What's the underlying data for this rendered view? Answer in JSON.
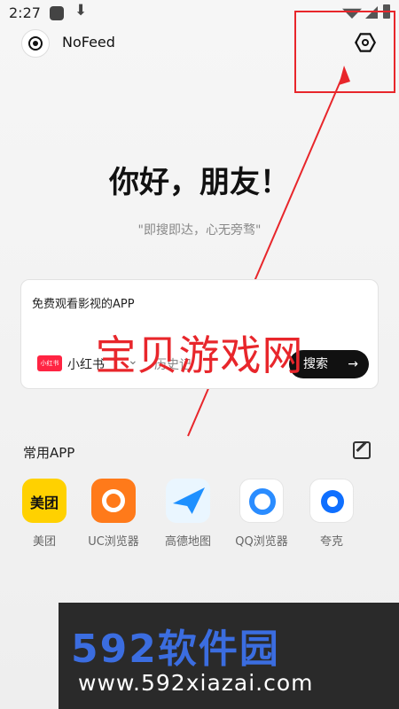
{
  "statusbar": {
    "time": "2:27",
    "icons": [
      "app-notification-icon",
      "download-icon",
      "wifi-icon",
      "signal-icon",
      "battery-icon"
    ]
  },
  "header": {
    "title": "NoFeed",
    "logo_icon": "target-logo-icon",
    "settings_icon": "hexagon-settings-icon"
  },
  "hero": {
    "greeting": "你好，朋友！",
    "slogan": "\"即搜即达，心无旁骛\""
  },
  "search": {
    "query": "免费观看影视的APP",
    "engine": {
      "logo_text": "小红书",
      "label": "小红书"
    },
    "history_label": "历史记",
    "button_label": "搜索",
    "button_arrow": "→"
  },
  "watermark_top": "宝贝游戏网",
  "common_apps": {
    "title": "常用APP",
    "edit_icon": "edit-icon",
    "items": [
      {
        "label": "美团",
        "icon_text": "美团",
        "color": "#ffd100"
      },
      {
        "label": "UC浏览器",
        "icon": "uc-browser-icon",
        "color": "#ff7a1a"
      },
      {
        "label": "高德地图",
        "icon": "gaode-map-icon",
        "color": "#1e90ff"
      },
      {
        "label": "QQ浏览器",
        "icon": "qq-browser-icon",
        "color": "#2a8cff"
      },
      {
        "label": "夸克",
        "icon": "quark-icon",
        "color": "#0f6fff"
      }
    ]
  },
  "banner": {
    "big": "592软件园",
    "small": "www.592xiazai.com"
  },
  "colors": {
    "accent_red": "#e8262b",
    "banner_blue": "#3b6de0"
  }
}
